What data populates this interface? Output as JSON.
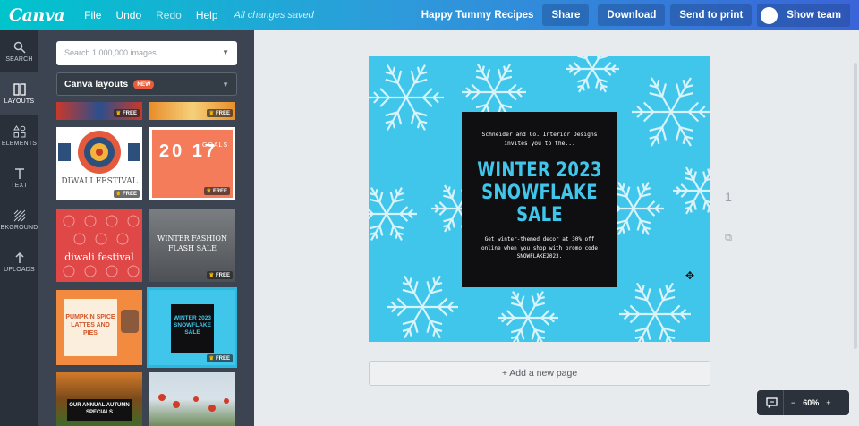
{
  "topbar": {
    "logo": "Canva",
    "menu": [
      "File",
      "Undo",
      "Redo",
      "Help"
    ],
    "saved_status": "All changes saved",
    "doc_name": "Happy Tummy Recipes",
    "share": "Share",
    "download": "Download",
    "send_to_print": "Send to print",
    "show_team": "Show team"
  },
  "rail": [
    {
      "label": "SEARCH",
      "icon": "search-icon"
    },
    {
      "label": "LAYOUTS",
      "icon": "layouts-icon"
    },
    {
      "label": "ELEMENTS",
      "icon": "elements-icon"
    },
    {
      "label": "TEXT",
      "icon": "text-icon"
    },
    {
      "label": "BKGROUND",
      "icon": "background-icon"
    },
    {
      "label": "UPLOADS",
      "icon": "upload-icon"
    }
  ],
  "panel": {
    "search_placeholder": "Search 1,000,000 images...",
    "layout_selector": "Canva layouts",
    "new_badge": "NEW",
    "free_label": "FREE",
    "thumbs": [
      {
        "name": "diwali-festival-pattern",
        "title": "DIWALI FESTIVAL"
      },
      {
        "name": "goals-2017",
        "title": "20 17",
        "subtitle": "GOALS"
      },
      {
        "name": "diwali-festival-red",
        "title": "diwali festival"
      },
      {
        "name": "winter-fashion-flash-sale",
        "title": "WINTER FASHION FLASH SALE"
      },
      {
        "name": "pumpkin-spice-lattes",
        "title": "PUMPKIN SPICE LATTES AND PIES"
      },
      {
        "name": "winter-2023-snowflake-sale",
        "title": "WINTER 2023 SNOWFLAKE SALE"
      },
      {
        "name": "our-annual-autumn-specials",
        "title": "OUR ANNUAL AUTUMN SPECIALS"
      },
      {
        "name": "red-poppies-photo",
        "title": ""
      }
    ]
  },
  "design": {
    "invite": "Schneider and Co. Interior Designs invites you to the...",
    "title_lines": [
      "WINTER 2023",
      "SNOWFLAKE",
      "SALE"
    ],
    "body": "Get winter-themed decor at 30% off online when you shop with promo code SNOWFLAKE2023.",
    "bg_color": "#3fc6ea",
    "card_color": "#0f0f12"
  },
  "page_number": "1",
  "add_page": "+ Add a new page",
  "zoom": {
    "minus": "−",
    "value": "60%",
    "plus": "+"
  }
}
